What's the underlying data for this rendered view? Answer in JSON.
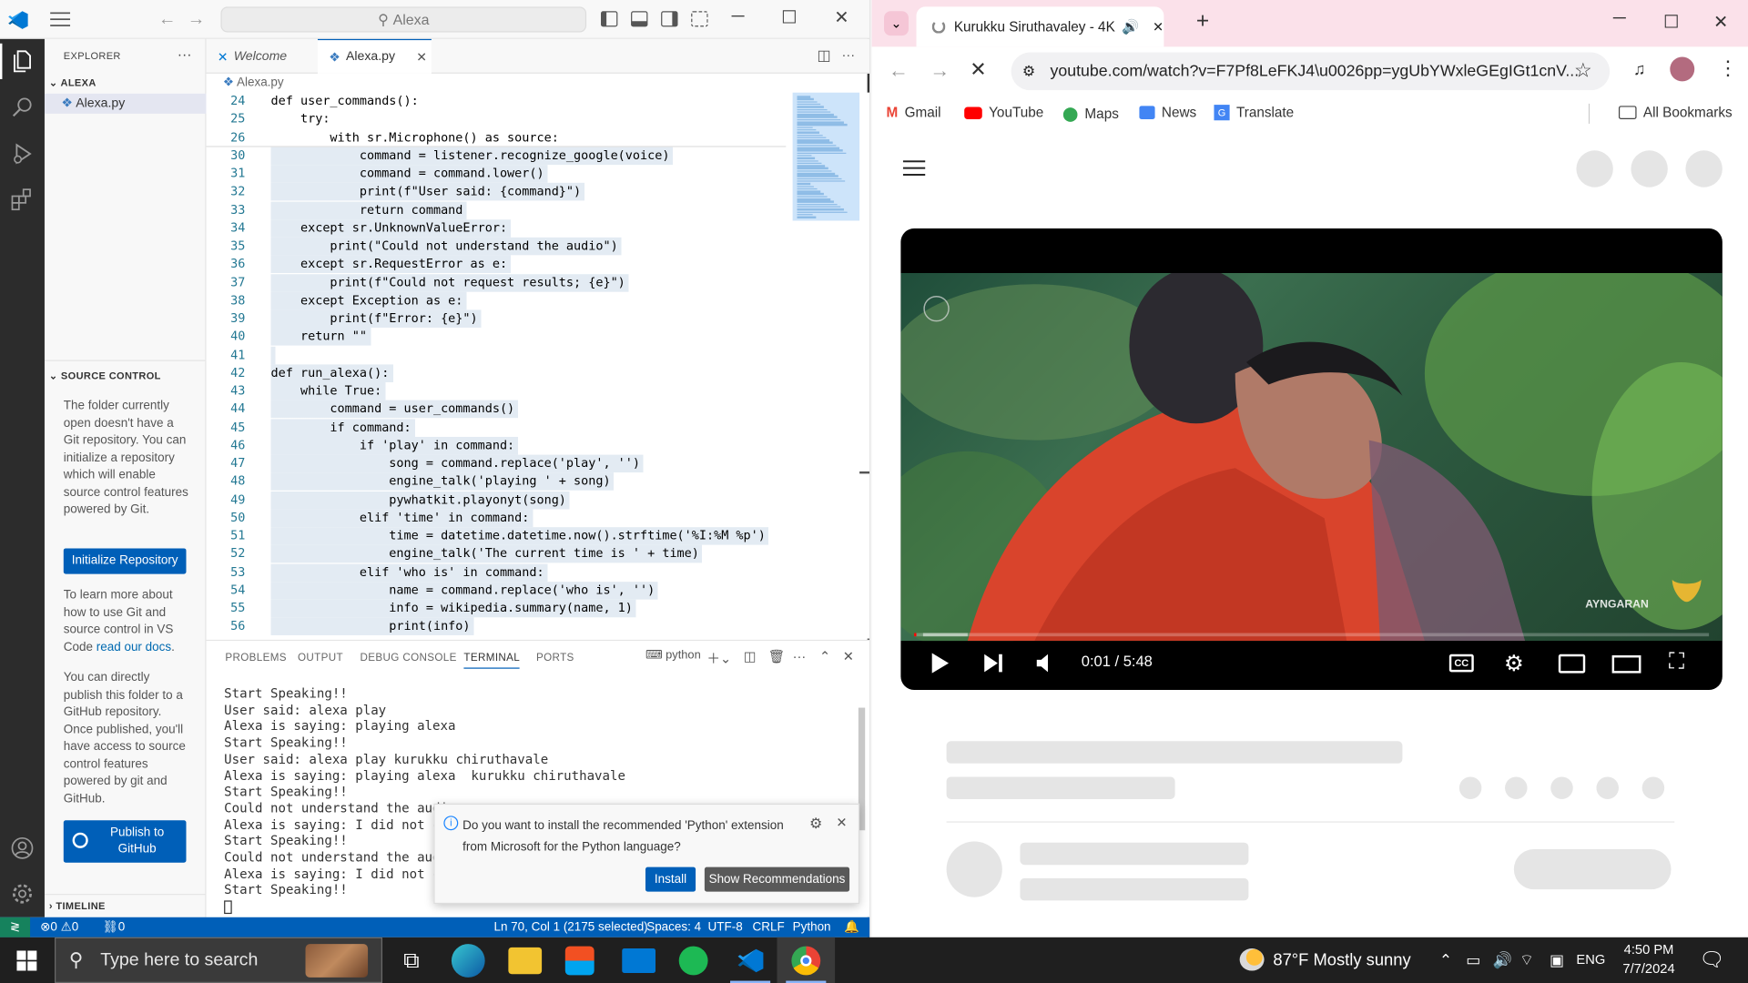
{
  "vscode": {
    "command_center": "Alexa",
    "explorer": {
      "header": "EXPLORER",
      "folder": "ALEXA",
      "file": "Alexa.py"
    },
    "source_control": {
      "header": "SOURCE CONTROL",
      "message": "The folder currently open doesn't have a Git repository. You can initialize a repository which will enable source control features powered by Git.",
      "init_button": "Initialize Repository",
      "learn_prefix": "To learn more about how to use Git and source control in VS Code ",
      "learn_link": "read our docs",
      "learn_suffix": ".",
      "publish_text": "You can directly publish this folder to a GitHub repository. Once published, you'll have access to source control features powered by git and GitHub.",
      "publish_button": "Publish to GitHub"
    },
    "timeline": "TIMELINE",
    "tabs": [
      "Welcome",
      "Alexa.py"
    ],
    "breadcrumb": "Alexa.py",
    "code_lines": [
      {
        "n": "24",
        "t": "def user_commands():"
      },
      {
        "n": "25",
        "t": "    try:"
      },
      {
        "n": "26",
        "t": "        with sr.Microphone() as source:"
      },
      {
        "n": "30",
        "t": "            command = listener.recognize_google(voice)"
      },
      {
        "n": "31",
        "t": "            command = command.lower()"
      },
      {
        "n": "32",
        "t": "            print(f\"User said: {command}\")"
      },
      {
        "n": "33",
        "t": "            return command"
      },
      {
        "n": "34",
        "t": "    except sr.UnknownValueError:"
      },
      {
        "n": "35",
        "t": "        print(\"Could not understand the audio\")"
      },
      {
        "n": "36",
        "t": "    except sr.RequestError as e:"
      },
      {
        "n": "37",
        "t": "        print(f\"Could not request results; {e}\")"
      },
      {
        "n": "38",
        "t": "    except Exception as e:"
      },
      {
        "n": "39",
        "t": "        print(f\"Error: {e}\")"
      },
      {
        "n": "40",
        "t": "    return \"\""
      },
      {
        "n": "41",
        "t": ""
      },
      {
        "n": "42",
        "t": "def run_alexa():"
      },
      {
        "n": "43",
        "t": "    while True:"
      },
      {
        "n": "44",
        "t": "        command = user_commands()"
      },
      {
        "n": "45",
        "t": "        if command:"
      },
      {
        "n": "46",
        "t": "            if 'play' in command:"
      },
      {
        "n": "47",
        "t": "                song = command.replace('play', '')"
      },
      {
        "n": "48",
        "t": "                engine_talk('playing ' + song)"
      },
      {
        "n": "49",
        "t": "                pywhatkit.playonyt(song)"
      },
      {
        "n": "50",
        "t": "            elif 'time' in command:"
      },
      {
        "n": "51",
        "t": "                time = datetime.datetime.now().strftime('%I:%M %p')"
      },
      {
        "n": "52",
        "t": "                engine_talk('The current time is ' + time)"
      },
      {
        "n": "53",
        "t": "            elif 'who is' in command:"
      },
      {
        "n": "54",
        "t": "                name = command.replace('who is', '')"
      },
      {
        "n": "55",
        "t": "                info = wikipedia.summary(name, 1)"
      },
      {
        "n": "56",
        "t": "                print(info)"
      }
    ],
    "panel_tabs": [
      "PROBLEMS",
      "OUTPUT",
      "DEBUG CONSOLE",
      "TERMINAL",
      "PORTS"
    ],
    "terminal_name": "python",
    "terminal_lines": [
      "Start Speaking!!",
      "User said: alexa play",
      "Alexa is saying: playing alexa",
      "Start Speaking!!",
      "User said: alexa play kurukku chiruthavale",
      "Alexa is saying: playing alexa  kurukku chiruthavale",
      "Start Speaking!!",
      "Could not understand the audi",
      "Alexa is saying: I did not ca",
      "Start Speaking!!",
      "Could not understand the audi",
      "Alexa is saying: I did not ca",
      "Start Speaking!!"
    ],
    "notification": {
      "message": "Do you want to install the recommended 'Python' extension from Microsoft for the Python language?",
      "install": "Install",
      "show": "Show Recommendations"
    },
    "status": {
      "errors": "0",
      "warnings": "0",
      "ports": "0",
      "position": "Ln 70, Col 1 (2175 selected)",
      "spaces": "Spaces: 4",
      "encoding": "UTF-8",
      "eol": "CRLF",
      "language": "Python"
    }
  },
  "chrome": {
    "tab_title": "Kurukku Siruthavaley - 4K V",
    "url": "youtube.com/watch?v=F7Pf8LeFKJ4\\u0026pp=ygUbYWxleGEgIGt1cnV...",
    "bookmarks": [
      "Gmail",
      "YouTube",
      "Maps",
      "News",
      "Translate"
    ],
    "all_bookmarks": "All Bookmarks",
    "player": {
      "time": "0:01 / 5:48",
      "watermark": "AYNGARAN",
      "progress": 0.003
    }
  },
  "taskbar": {
    "search_placeholder": "Type here to search",
    "weather": "87°F  Mostly sunny",
    "lang": "ENG",
    "time": "4:50 PM",
    "date": "7/7/2024"
  },
  "colors": {
    "vscode_blue": "#005fb8",
    "chrome_tab_pink": "#fbe1ea",
    "taskbar": "#1f1f1f"
  }
}
